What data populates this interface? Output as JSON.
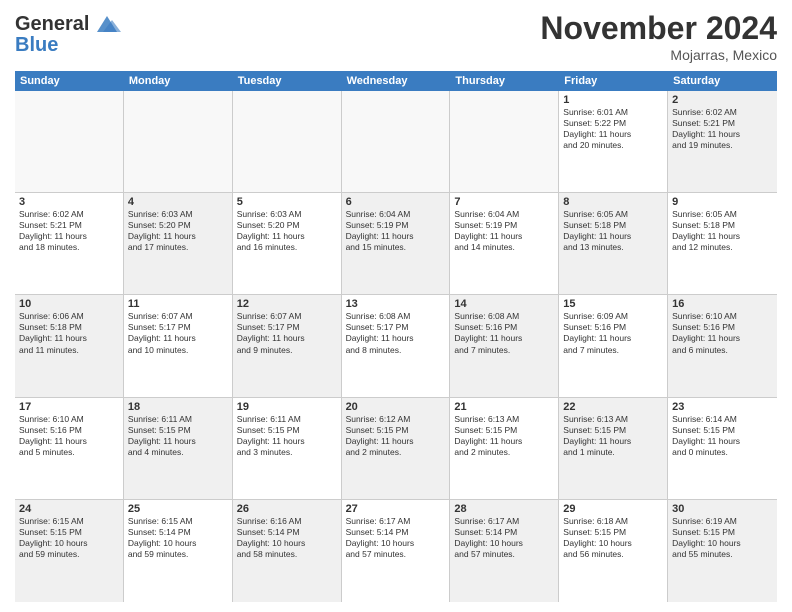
{
  "logo": {
    "line1": "General",
    "line2": "Blue"
  },
  "title": "November 2024",
  "location": "Mojarras, Mexico",
  "header_days": [
    "Sunday",
    "Monday",
    "Tuesday",
    "Wednesday",
    "Thursday",
    "Friday",
    "Saturday"
  ],
  "weeks": [
    [
      {
        "day": "",
        "content": "",
        "empty": true
      },
      {
        "day": "",
        "content": "",
        "empty": true
      },
      {
        "day": "",
        "content": "",
        "empty": true
      },
      {
        "day": "",
        "content": "",
        "empty": true
      },
      {
        "day": "",
        "content": "",
        "empty": true
      },
      {
        "day": "1",
        "content": "Sunrise: 6:01 AM\nSunset: 5:22 PM\nDaylight: 11 hours\nand 20 minutes."
      },
      {
        "day": "2",
        "content": "Sunrise: 6:02 AM\nSunset: 5:21 PM\nDaylight: 11 hours\nand 19 minutes.",
        "shaded": true
      }
    ],
    [
      {
        "day": "3",
        "content": "Sunrise: 6:02 AM\nSunset: 5:21 PM\nDaylight: 11 hours\nand 18 minutes."
      },
      {
        "day": "4",
        "content": "Sunrise: 6:03 AM\nSunset: 5:20 PM\nDaylight: 11 hours\nand 17 minutes.",
        "shaded": true
      },
      {
        "day": "5",
        "content": "Sunrise: 6:03 AM\nSunset: 5:20 PM\nDaylight: 11 hours\nand 16 minutes."
      },
      {
        "day": "6",
        "content": "Sunrise: 6:04 AM\nSunset: 5:19 PM\nDaylight: 11 hours\nand 15 minutes.",
        "shaded": true
      },
      {
        "day": "7",
        "content": "Sunrise: 6:04 AM\nSunset: 5:19 PM\nDaylight: 11 hours\nand 14 minutes."
      },
      {
        "day": "8",
        "content": "Sunrise: 6:05 AM\nSunset: 5:18 PM\nDaylight: 11 hours\nand 13 minutes.",
        "shaded": true
      },
      {
        "day": "9",
        "content": "Sunrise: 6:05 AM\nSunset: 5:18 PM\nDaylight: 11 hours\nand 12 minutes."
      }
    ],
    [
      {
        "day": "10",
        "content": "Sunrise: 6:06 AM\nSunset: 5:18 PM\nDaylight: 11 hours\nand 11 minutes.",
        "shaded": true
      },
      {
        "day": "11",
        "content": "Sunrise: 6:07 AM\nSunset: 5:17 PM\nDaylight: 11 hours\nand 10 minutes."
      },
      {
        "day": "12",
        "content": "Sunrise: 6:07 AM\nSunset: 5:17 PM\nDaylight: 11 hours\nand 9 minutes.",
        "shaded": true
      },
      {
        "day": "13",
        "content": "Sunrise: 6:08 AM\nSunset: 5:17 PM\nDaylight: 11 hours\nand 8 minutes."
      },
      {
        "day": "14",
        "content": "Sunrise: 6:08 AM\nSunset: 5:16 PM\nDaylight: 11 hours\nand 7 minutes.",
        "shaded": true
      },
      {
        "day": "15",
        "content": "Sunrise: 6:09 AM\nSunset: 5:16 PM\nDaylight: 11 hours\nand 7 minutes."
      },
      {
        "day": "16",
        "content": "Sunrise: 6:10 AM\nSunset: 5:16 PM\nDaylight: 11 hours\nand 6 minutes.",
        "shaded": true
      }
    ],
    [
      {
        "day": "17",
        "content": "Sunrise: 6:10 AM\nSunset: 5:16 PM\nDaylight: 11 hours\nand 5 minutes."
      },
      {
        "day": "18",
        "content": "Sunrise: 6:11 AM\nSunset: 5:15 PM\nDaylight: 11 hours\nand 4 minutes.",
        "shaded": true
      },
      {
        "day": "19",
        "content": "Sunrise: 6:11 AM\nSunset: 5:15 PM\nDaylight: 11 hours\nand 3 minutes."
      },
      {
        "day": "20",
        "content": "Sunrise: 6:12 AM\nSunset: 5:15 PM\nDaylight: 11 hours\nand 2 minutes.",
        "shaded": true
      },
      {
        "day": "21",
        "content": "Sunrise: 6:13 AM\nSunset: 5:15 PM\nDaylight: 11 hours\nand 2 minutes."
      },
      {
        "day": "22",
        "content": "Sunrise: 6:13 AM\nSunset: 5:15 PM\nDaylight: 11 hours\nand 1 minute.",
        "shaded": true
      },
      {
        "day": "23",
        "content": "Sunrise: 6:14 AM\nSunset: 5:15 PM\nDaylight: 11 hours\nand 0 minutes."
      }
    ],
    [
      {
        "day": "24",
        "content": "Sunrise: 6:15 AM\nSunset: 5:15 PM\nDaylight: 10 hours\nand 59 minutes.",
        "shaded": true
      },
      {
        "day": "25",
        "content": "Sunrise: 6:15 AM\nSunset: 5:14 PM\nDaylight: 10 hours\nand 59 minutes."
      },
      {
        "day": "26",
        "content": "Sunrise: 6:16 AM\nSunset: 5:14 PM\nDaylight: 10 hours\nand 58 minutes.",
        "shaded": true
      },
      {
        "day": "27",
        "content": "Sunrise: 6:17 AM\nSunset: 5:14 PM\nDaylight: 10 hours\nand 57 minutes."
      },
      {
        "day": "28",
        "content": "Sunrise: 6:17 AM\nSunset: 5:14 PM\nDaylight: 10 hours\nand 57 minutes.",
        "shaded": true
      },
      {
        "day": "29",
        "content": "Sunrise: 6:18 AM\nSunset: 5:15 PM\nDaylight: 10 hours\nand 56 minutes."
      },
      {
        "day": "30",
        "content": "Sunrise: 6:19 AM\nSunset: 5:15 PM\nDaylight: 10 hours\nand 55 minutes.",
        "shaded": true
      }
    ]
  ]
}
